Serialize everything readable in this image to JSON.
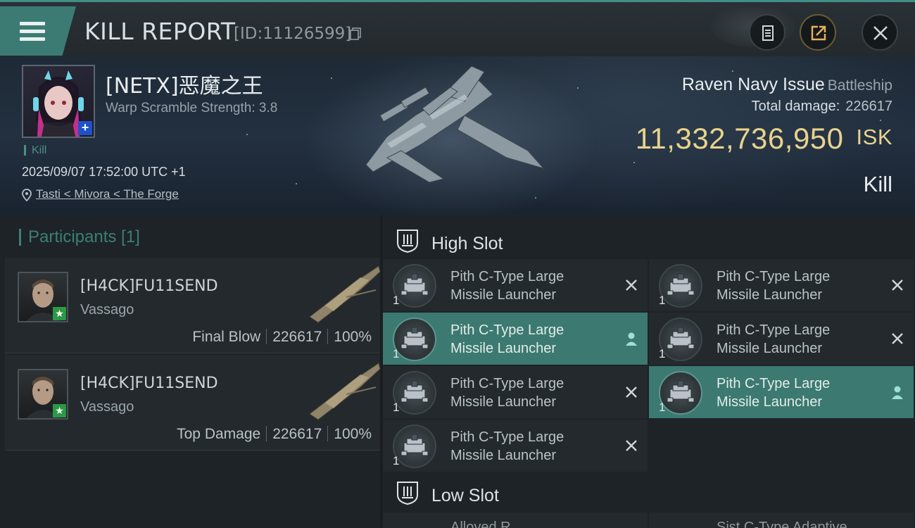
{
  "header": {
    "title": "KILL REPORT",
    "report_id": "[ID:11126599]",
    "icons": [
      "menu-icon",
      "copy-icon",
      "clipboard-icon",
      "share-icon",
      "close-icon"
    ]
  },
  "victim": {
    "name": "[NETX]恶魔之王",
    "warp_scramble": "Warp Scramble Strength: 3.8",
    "status_tag": "Kill",
    "datetime": "2025/09/07 17:52:00 UTC +1",
    "location": "Tasti < Mivora < The Forge"
  },
  "ship": {
    "name": "Raven Navy Issue",
    "class": "Battleship",
    "total_damage_label": "Total damage:",
    "total_damage": "226617",
    "isk_value": "11,332,736,950",
    "isk_unit": "ISK",
    "result": "Kill"
  },
  "participants": {
    "title": "Participants [1]",
    "items": [
      {
        "name": "[H4CK]FU11SEND",
        "ship": "Vassago",
        "role": "Final Blow",
        "damage": "226617",
        "percent": "100%"
      },
      {
        "name": "[H4CK]FU11SEND",
        "ship": "Vassago",
        "role": "Top Damage",
        "damage": "226617",
        "percent": "100%"
      }
    ]
  },
  "slots": {
    "high": {
      "label": "High Slot",
      "modules": [
        {
          "line1": "Pith C-Type Large",
          "line2": "Missile Launcher",
          "qty": "1",
          "status": "destroyed"
        },
        {
          "line1": "Pith C-Type Large",
          "line2": "Missile Launcher",
          "qty": "1",
          "status": "destroyed"
        },
        {
          "line1": "Pith C-Type Large",
          "line2": "Missile Launcher",
          "qty": "1",
          "status": "dropped"
        },
        {
          "line1": "Pith C-Type Large",
          "line2": "Missile Launcher",
          "qty": "1",
          "status": "destroyed"
        },
        {
          "line1": "Pith C-Type Large",
          "line2": "Missile Launcher",
          "qty": "1",
          "status": "destroyed"
        },
        {
          "line1": "Pith C-Type Large",
          "line2": "Missile Launcher",
          "qty": "1",
          "status": "dropped"
        },
        {
          "line1": "Pith C-Type Large",
          "line2": "Missile Launcher",
          "qty": "1",
          "status": "destroyed"
        }
      ]
    },
    "low": {
      "label": "Low Slot",
      "peek": [
        "Alloyed R...",
        "Sist C-Type Adaptive..."
      ]
    }
  },
  "colors": {
    "accent_teal": "#3b7971",
    "isk_gold": "#e9d28d",
    "background": "#1e2327"
  }
}
